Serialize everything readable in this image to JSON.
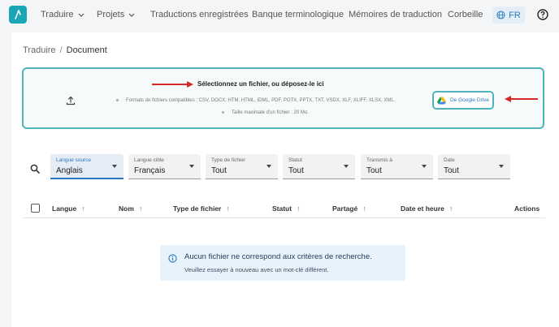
{
  "nav": {
    "items": [
      {
        "label": "Traduire",
        "has_dropdown": true
      },
      {
        "label": "Projets",
        "has_dropdown": true
      },
      {
        "label": "Traductions enregistrées",
        "has_dropdown": false
      },
      {
        "label": "Banque terminologique",
        "has_dropdown": false
      },
      {
        "label": "Mémoires de traduction",
        "has_dropdown": false
      },
      {
        "label": "Corbeille",
        "has_dropdown": false
      }
    ],
    "language": "FR",
    "logo_icon": "logo-icon",
    "help_icon": "help-circle-icon",
    "accent_color": "#19a7b8"
  },
  "breadcrumb": {
    "parent": "Traduire",
    "separator": "/",
    "current": "Document"
  },
  "dropzone": {
    "title": "Sélectionnez un fichier, ou déposez-le ici",
    "formats": "Formats de fichiers compatibles : CSV, DOCX, HTM, HTML, IDML, PDF, POTX, PPTX, TXT, VSDX, XLF, XLIFF, XLSX, XML.",
    "max_size": "Taille maximale d'un fichier : 20 Mo.",
    "google_drive_label": "De Google Drive",
    "upload_icon": "upload-icon",
    "border_color": "#4fb4bd",
    "annotation_arrow_color": "#d62828"
  },
  "filters": [
    {
      "label": "Langue source",
      "value": "Anglais",
      "active": true
    },
    {
      "label": "Langue cible",
      "value": "Français",
      "active": false
    },
    {
      "label": "Type de fichier",
      "value": "Tout",
      "active": false
    },
    {
      "label": "Statut",
      "value": "Tout",
      "active": false
    },
    {
      "label": "Transmis à",
      "value": "Tout",
      "active": false
    },
    {
      "label": "Date",
      "value": "Tout",
      "active": false
    }
  ],
  "table": {
    "columns": [
      "Langue",
      "Nom",
      "Type de fichier",
      "Statut",
      "Partagé",
      "Date et heure",
      "Actions"
    ]
  },
  "empty_state": {
    "title": "Aucun fichier ne correspond aux critères de recherche.",
    "subtitle": "Veuillez essayer à nouveau avec un mot-clé différent."
  }
}
